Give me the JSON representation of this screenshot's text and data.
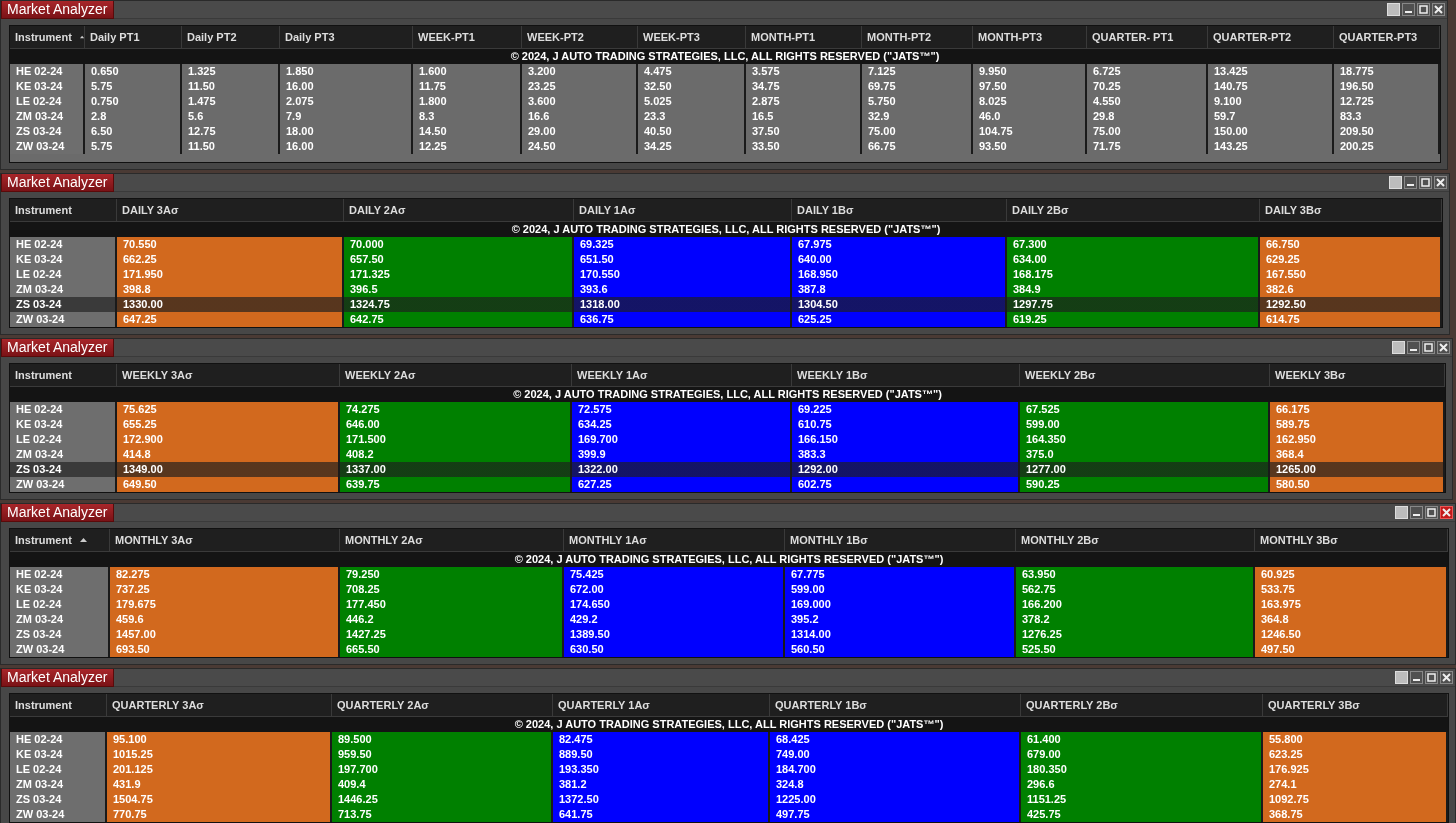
{
  "windows": [
    {
      "title": "Market Analyzer",
      "sort_ascending": true,
      "close_highlighted": false,
      "notice": "© 2024, J AUTO TRADING STRATEGIES, LLC, ALL RIGHTS RESERVED (\"JATS™\")",
      "columns": [
        {
          "label": "Instrument"
        },
        {
          "label": "Daily PT1"
        },
        {
          "label": "Daily PT2"
        },
        {
          "label": "Daily PT3"
        },
        {
          "label": "WEEK-PT1"
        },
        {
          "label": "WEEK-PT2"
        },
        {
          "label": "WEEK-PT3"
        },
        {
          "label": "MONTH-PT1"
        },
        {
          "label": "MONTH-PT2"
        },
        {
          "label": "MONTH-PT3"
        },
        {
          "label": "QUARTER- PT1"
        },
        {
          "label": "QUARTER-PT2"
        },
        {
          "label": "QUARTER-PT3"
        }
      ],
      "rows": [
        {
          "instrument": "HE 02-24",
          "selected": false,
          "values": [
            "0.650",
            "1.325",
            "1.850",
            "1.600",
            "3.200",
            "4.475",
            "3.575",
            "7.125",
            "9.950",
            "6.725",
            "13.425",
            "18.775"
          ]
        },
        {
          "instrument": "KE 03-24",
          "selected": false,
          "values": [
            "5.75",
            "11.50",
            "16.00",
            "11.75",
            "23.25",
            "32.50",
            "34.75",
            "69.75",
            "97.50",
            "70.25",
            "140.75",
            "196.50"
          ]
        },
        {
          "instrument": "LE 02-24",
          "selected": false,
          "values": [
            "0.750",
            "1.475",
            "2.075",
            "1.800",
            "3.600",
            "5.025",
            "2.875",
            "5.750",
            "8.025",
            "4.550",
            "9.100",
            "12.725"
          ]
        },
        {
          "instrument": "ZM 03-24",
          "selected": false,
          "values": [
            "2.8",
            "5.6",
            "7.9",
            "8.3",
            "16.6",
            "23.3",
            "16.5",
            "32.9",
            "46.0",
            "29.8",
            "59.7",
            "83.3"
          ]
        },
        {
          "instrument": "ZS 03-24",
          "selected": false,
          "values": [
            "6.50",
            "12.75",
            "18.00",
            "14.50",
            "29.00",
            "40.50",
            "37.50",
            "75.00",
            "104.75",
            "75.00",
            "150.00",
            "209.50"
          ]
        },
        {
          "instrument": "ZW 03-24",
          "selected": false,
          "values": [
            "5.75",
            "11.50",
            "16.00",
            "12.25",
            "24.50",
            "34.25",
            "33.50",
            "66.75",
            "93.50",
            "71.75",
            "143.25",
            "200.25"
          ]
        }
      ]
    },
    {
      "title": "Market Analyzer",
      "sort_ascending": false,
      "close_highlighted": false,
      "notice": "© 2024, J AUTO TRADING STRATEGIES, LLC, ALL RIGHTS RESERVED (\"JATS™\")",
      "columns": [
        {
          "label": "Instrument"
        },
        {
          "label": "DAILY 3Aσ",
          "color": "#d2691e"
        },
        {
          "label": "DAILY 2Aσ",
          "color": "#008000"
        },
        {
          "label": "DAILY 1Aσ",
          "color": "#0000ff"
        },
        {
          "label": "DAILY 1Bσ",
          "color": "#0000ff"
        },
        {
          "label": "DAILY 2Bσ",
          "color": "#008000"
        },
        {
          "label": "DAILY 3Bσ",
          "color": "#d2691e"
        }
      ],
      "rows": [
        {
          "instrument": "HE 02-24",
          "selected": false,
          "values": [
            "70.550",
            "70.000",
            "69.325",
            "67.975",
            "67.300",
            "66.750"
          ]
        },
        {
          "instrument": "KE 03-24",
          "selected": false,
          "values": [
            "662.25",
            "657.50",
            "651.50",
            "640.00",
            "634.00",
            "629.25"
          ]
        },
        {
          "instrument": "LE 02-24",
          "selected": false,
          "values": [
            "171.950",
            "171.325",
            "170.550",
            "168.950",
            "168.175",
            "167.550"
          ]
        },
        {
          "instrument": "ZM 03-24",
          "selected": false,
          "values": [
            "398.8",
            "396.5",
            "393.6",
            "387.8",
            "384.9",
            "382.6"
          ]
        },
        {
          "instrument": "ZS 03-24",
          "selected": true,
          "values": [
            "1330.00",
            "1324.75",
            "1318.00",
            "1304.50",
            "1297.75",
            "1292.50"
          ]
        },
        {
          "instrument": "ZW 03-24",
          "selected": false,
          "values": [
            "647.25",
            "642.75",
            "636.75",
            "625.25",
            "619.25",
            "614.75"
          ]
        }
      ]
    },
    {
      "title": "Market Analyzer",
      "sort_ascending": false,
      "close_highlighted": false,
      "notice": "© 2024, J AUTO TRADING STRATEGIES, LLC, ALL RIGHTS RESERVED (\"JATS™\")",
      "columns": [
        {
          "label": "Instrument"
        },
        {
          "label": "WEEKLY 3Aσ",
          "color": "#d2691e"
        },
        {
          "label": "WEEKLY 2Aσ",
          "color": "#008000"
        },
        {
          "label": "WEEKLY 1Aσ",
          "color": "#0000ff"
        },
        {
          "label": "WEEKLY 1Bσ",
          "color": "#0000ff"
        },
        {
          "label": "WEEKLY 2Bσ",
          "color": "#008000"
        },
        {
          "label": "WEEKLY 3Bσ",
          "color": "#d2691e"
        }
      ],
      "rows": [
        {
          "instrument": "HE 02-24",
          "selected": false,
          "values": [
            "75.625",
            "74.275",
            "72.575",
            "69.225",
            "67.525",
            "66.175"
          ]
        },
        {
          "instrument": "KE 03-24",
          "selected": false,
          "values": [
            "655.25",
            "646.00",
            "634.25",
            "610.75",
            "599.00",
            "589.75"
          ]
        },
        {
          "instrument": "LE 02-24",
          "selected": false,
          "values": [
            "172.900",
            "171.500",
            "169.700",
            "166.150",
            "164.350",
            "162.950"
          ]
        },
        {
          "instrument": "ZM 03-24",
          "selected": false,
          "values": [
            "414.8",
            "408.2",
            "399.9",
            "383.3",
            "375.0",
            "368.4"
          ]
        },
        {
          "instrument": "ZS 03-24",
          "selected": true,
          "values": [
            "1349.00",
            "1337.00",
            "1322.00",
            "1292.00",
            "1277.00",
            "1265.00"
          ]
        },
        {
          "instrument": "ZW 03-24",
          "selected": false,
          "values": [
            "649.50",
            "639.75",
            "627.25",
            "602.75",
            "590.25",
            "580.50"
          ]
        }
      ]
    },
    {
      "title": "Market Analyzer",
      "sort_ascending": true,
      "close_highlighted": true,
      "notice": "© 2024, J AUTO TRADING STRATEGIES, LLC, ALL RIGHTS RESERVED (\"JATS™\")",
      "columns": [
        {
          "label": "Instrument"
        },
        {
          "label": "MONTHLY 3Aσ",
          "color": "#d2691e"
        },
        {
          "label": "MONTHLY 2Aσ",
          "color": "#008000"
        },
        {
          "label": "MONTHLY 1Aσ",
          "color": "#0000ff"
        },
        {
          "label": "MONTHLY 1Bσ",
          "color": "#0000ff"
        },
        {
          "label": "MONTHLY 2Bσ",
          "color": "#008000"
        },
        {
          "label": "MONTHLY 3Bσ",
          "color": "#d2691e"
        }
      ],
      "rows": [
        {
          "instrument": "HE 02-24",
          "selected": false,
          "values": [
            "82.275",
            "79.250",
            "75.425",
            "67.775",
            "63.950",
            "60.925"
          ]
        },
        {
          "instrument": "KE 03-24",
          "selected": false,
          "values": [
            "737.25",
            "708.25",
            "672.00",
            "599.00",
            "562.75",
            "533.75"
          ]
        },
        {
          "instrument": "LE 02-24",
          "selected": false,
          "values": [
            "179.675",
            "177.450",
            "174.650",
            "169.000",
            "166.200",
            "163.975"
          ]
        },
        {
          "instrument": "ZM 03-24",
          "selected": false,
          "values": [
            "459.6",
            "446.2",
            "429.2",
            "395.2",
            "378.2",
            "364.8"
          ]
        },
        {
          "instrument": "ZS 03-24",
          "selected": false,
          "values": [
            "1457.00",
            "1427.25",
            "1389.50",
            "1314.00",
            "1276.25",
            "1246.50"
          ]
        },
        {
          "instrument": "ZW 03-24",
          "selected": false,
          "values": [
            "693.50",
            "665.50",
            "630.50",
            "560.50",
            "525.50",
            "497.50"
          ]
        }
      ]
    },
    {
      "title": "Market Analyzer",
      "sort_ascending": false,
      "close_highlighted": false,
      "notice": "© 2024, J AUTO TRADING STRATEGIES, LLC, ALL RIGHTS RESERVED (\"JATS™\")",
      "columns": [
        {
          "label": "Instrument"
        },
        {
          "label": "QUARTERLY 3Aσ",
          "color": "#d2691e"
        },
        {
          "label": "QUARTERLY 2Aσ",
          "color": "#008000"
        },
        {
          "label": "QUARTERLY 1Aσ",
          "color": "#0000ff"
        },
        {
          "label": "QUARTERLY 1Bσ",
          "color": "#0000ff"
        },
        {
          "label": "QUARTERLY 2Bσ",
          "color": "#008000"
        },
        {
          "label": "QUARTERLY 3Bσ",
          "color": "#d2691e"
        }
      ],
      "rows": [
        {
          "instrument": "HE 02-24",
          "selected": false,
          "values": [
            "95.100",
            "89.500",
            "82.475",
            "68.425",
            "61.400",
            "55.800"
          ]
        },
        {
          "instrument": "KE 03-24",
          "selected": false,
          "values": [
            "1015.25",
            "959.50",
            "889.50",
            "749.00",
            "679.00",
            "623.25"
          ]
        },
        {
          "instrument": "LE 02-24",
          "selected": false,
          "values": [
            "201.125",
            "197.700",
            "193.350",
            "184.700",
            "180.350",
            "176.925"
          ]
        },
        {
          "instrument": "ZM 03-24",
          "selected": false,
          "values": [
            "431.9",
            "409.4",
            "381.2",
            "324.8",
            "296.6",
            "274.1"
          ]
        },
        {
          "instrument": "ZS 03-24",
          "selected": false,
          "values": [
            "1504.75",
            "1446.25",
            "1372.50",
            "1225.00",
            "1151.25",
            "1092.75"
          ]
        },
        {
          "instrument": "ZW 03-24",
          "selected": false,
          "values": [
            "770.75",
            "713.75",
            "641.75",
            "497.75",
            "425.75",
            "368.75"
          ]
        }
      ]
    }
  ]
}
